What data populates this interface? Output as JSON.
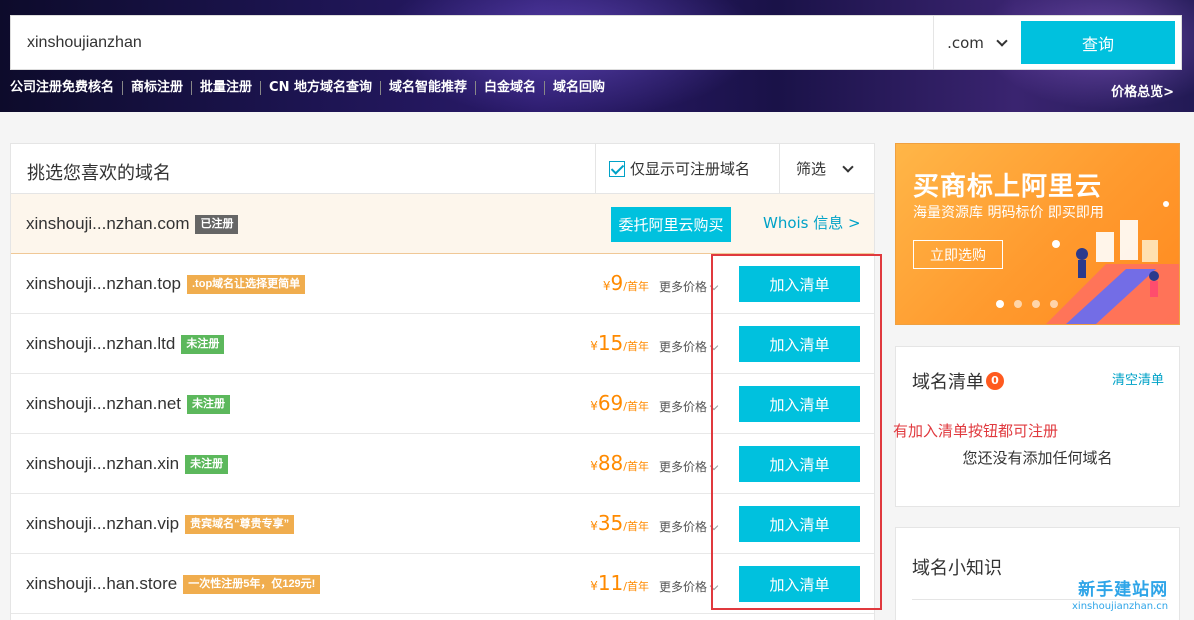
{
  "header": {
    "search_value": "xinshoujianzhan",
    "suffix": ".com",
    "query_label": "查询",
    "quick_links": [
      "公司注册免费核名",
      "商标注册",
      "批量注册",
      "CN 地方域名查询",
      "域名智能推荐",
      "白金域名",
      "域名回购"
    ],
    "price_overview": "价格总览>"
  },
  "panel": {
    "title": "挑选您喜欢的域名",
    "only_available": "仅显示可注册域名",
    "only_available_checked": true,
    "filter_label": "筛选"
  },
  "registered_row": {
    "domain": "xinshouji...nzhan.com",
    "badge": "已注册",
    "entrust_label": "委托阿里云购买",
    "whois_label": "Whois 信息 >"
  },
  "rows": [
    {
      "domain": "xinshouji...nzhan.top",
      "badge": ".top域名让选择更简单",
      "badge_color": "orange",
      "yen": "¥",
      "price": "9",
      "unit": "/首年",
      "more": "更多价格",
      "add": "加入清单"
    },
    {
      "domain": "xinshouji...nzhan.ltd",
      "badge": "未注册",
      "badge_color": "green",
      "yen": "¥",
      "price": "15",
      "unit": "/首年",
      "more": "更多价格",
      "add": "加入清单"
    },
    {
      "domain": "xinshouji...nzhan.net",
      "badge": "未注册",
      "badge_color": "green",
      "yen": "¥",
      "price": "69",
      "unit": "/首年",
      "more": "更多价格",
      "add": "加入清单"
    },
    {
      "domain": "xinshouji...nzhan.xin",
      "badge": "未注册",
      "badge_color": "green",
      "yen": "¥",
      "price": "88",
      "unit": "/首年",
      "more": "更多价格",
      "add": "加入清单"
    },
    {
      "domain": "xinshouji...nzhan.vip",
      "badge": "贵宾域名“尊贵专享”",
      "badge_color": "orange",
      "yen": "¥",
      "price": "35",
      "unit": "/首年",
      "more": "更多价格",
      "add": "加入清单"
    },
    {
      "domain": "xinshouji...han.store",
      "badge": "一次性注册5年，仅129元!",
      "badge_color": "orange",
      "yen": "¥",
      "price": "11",
      "unit": "/首年",
      "more": "更多价格",
      "add": "加入清单"
    }
  ],
  "ad": {
    "title": "买商标上阿里云",
    "subtitle": "海量资源库 明码标价 即买即用",
    "button": "立即选购"
  },
  "cart": {
    "title": "域名清单",
    "count": "0",
    "clear_label": "清空清单",
    "empty_text": "您还没有添加任何域名"
  },
  "annotation": "有加入清单按钮都可注册",
  "knowledge": {
    "title": "域名小知识"
  },
  "watermark": {
    "cn": "新手建站网",
    "en": "xinshoujianzhan.cn"
  },
  "colors": {
    "accent": "#00c1de",
    "price": "#ff8a00",
    "highlight_frame": "#e0393e",
    "badge_green": "#5cb85c",
    "badge_orange": "#f0ad4e"
  }
}
